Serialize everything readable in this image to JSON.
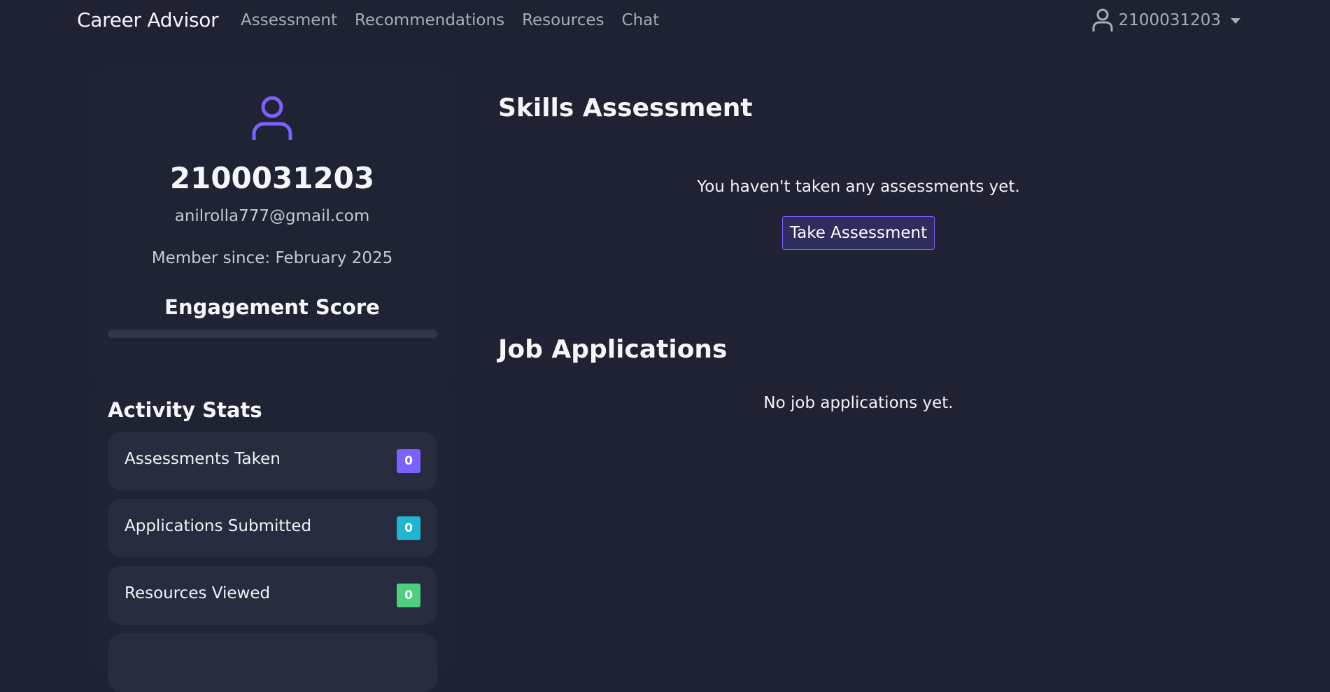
{
  "navbar": {
    "brand": "Career Advisor",
    "links": [
      "Assessment",
      "Recommendations",
      "Resources",
      "Chat"
    ],
    "user": {
      "icon": "user-icon",
      "label": "2100031203"
    }
  },
  "profile": {
    "icon": "user-icon",
    "username": "2100031203",
    "email": "anilrolla777@gmail.com",
    "member_since": "Member since: February 2025",
    "engagement_title": "Engagement Score",
    "engagement_score_percent": 0
  },
  "activity_stats": {
    "title": "Activity Stats",
    "items": [
      {
        "label": "Assessments Taken",
        "value": "0",
        "color": "#7b61ff"
      },
      {
        "label": "Applications Submitted",
        "value": "0",
        "color": "#1fb6d6"
      },
      {
        "label": "Resources Viewed",
        "value": "0",
        "color": "#4cd07d"
      }
    ]
  },
  "skills_assessment": {
    "title": "Skills Assessment",
    "empty_message": "You haven't taken any assessments yet.",
    "button_label": "Take Assessment"
  },
  "job_applications": {
    "title": "Job Applications",
    "empty_message": "No job applications yet."
  },
  "colors": {
    "background": "#1e2233",
    "accent": "#7b61ff"
  }
}
